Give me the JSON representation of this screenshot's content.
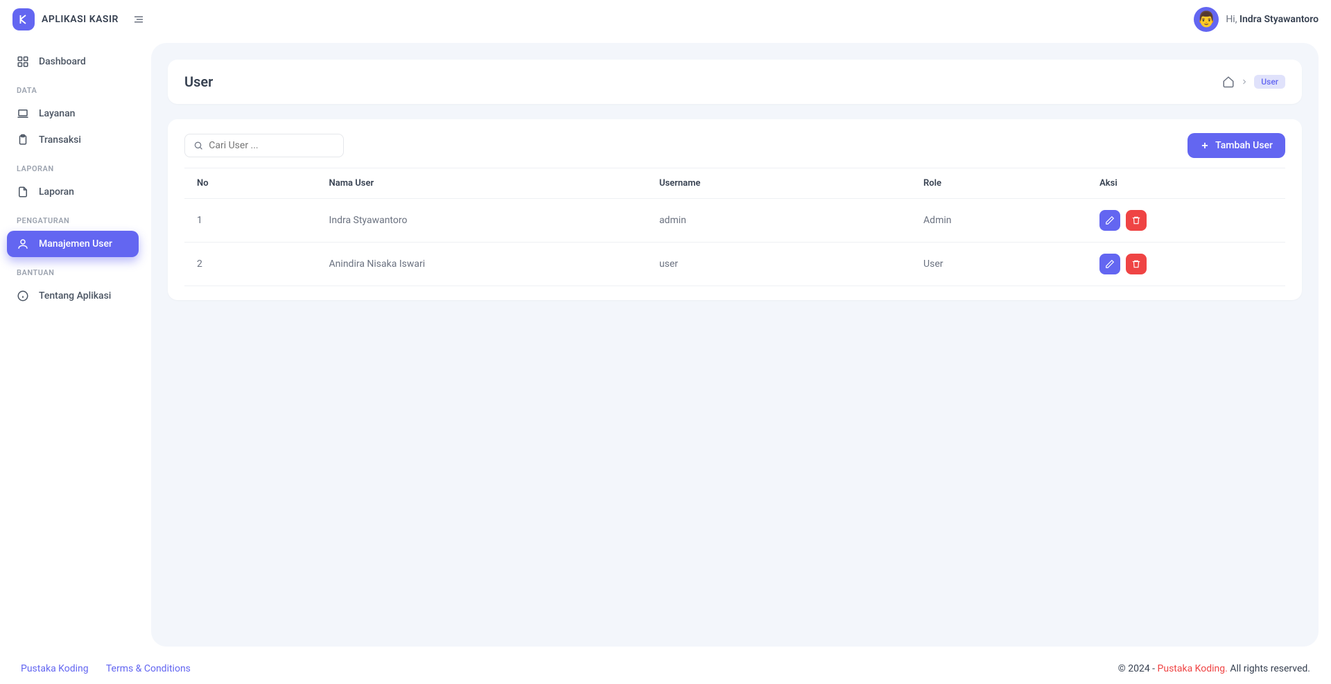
{
  "app": {
    "name": "APLIKASI KASIR"
  },
  "user": {
    "greeting": "Hi,",
    "name": "Indra Styawantoro"
  },
  "sidebar": {
    "dashboard": "Dashboard",
    "sections": {
      "data": "DATA",
      "laporan": "LAPORAN",
      "pengaturan": "PENGATURAN",
      "bantuan": "BANTUAN"
    },
    "items": {
      "layanan": "Layanan",
      "transaksi": "Transaksi",
      "laporan": "Laporan",
      "manajemen_user": "Manajemen User",
      "tentang": "Tentang Aplikasi"
    }
  },
  "page": {
    "title": "User",
    "search_placeholder": "Cari User ...",
    "add_button": "Tambah User",
    "breadcrumb_current": "User"
  },
  "table": {
    "headers": {
      "no": "No",
      "nama": "Nama User",
      "username": "Username",
      "role": "Role",
      "aksi": "Aksi"
    },
    "rows": [
      {
        "no": "1",
        "nama": "Indra Styawantoro",
        "username": "admin",
        "role": "Admin"
      },
      {
        "no": "2",
        "nama": "Anindira Nisaka Iswari",
        "username": "user",
        "role": "User"
      }
    ]
  },
  "footer": {
    "link1": "Pustaka Koding",
    "link2": "Terms & Conditions",
    "copyright_pre": "© 2024 - ",
    "brand": "Pustaka Koding.",
    "copyright_post": " All rights reserved."
  }
}
